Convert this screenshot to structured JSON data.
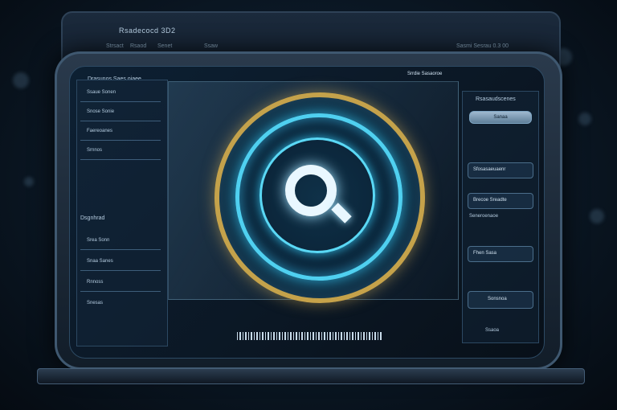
{
  "back_monitor": {
    "title": "Rsadecocd 3D2",
    "menu": [
      "Strsact",
      "Rsaod",
      "Senet",
      "Ssaw"
    ],
    "right_text": "Sasmi Sesrau 0.3  00"
  },
  "screen": {
    "top_left_title": "Drasunos Saes oiaee",
    "top_pill": "Srrdie Sasaoroe",
    "left_panel": {
      "heading": "Dsgnhrad",
      "rows": [
        "Ssaue Sonen",
        "Snose Sonie",
        "Faereoanes",
        "Srnnos",
        "Srea Sonn",
        "Snaa Sanes",
        "Rnnoss",
        "Snesas"
      ]
    },
    "right_panel": {
      "heading": "Rsasaudscenes",
      "button": "Sanaa",
      "items": [
        "Sfosasaeuaenr",
        "Brecoe Sreadte",
        "Seneroenaoe",
        "Fhen Sasa",
        "Sonsnoa",
        "Ssaoa"
      ]
    },
    "barcode_label": "|||| |||| |||||| ||||"
  },
  "colors": {
    "accent_cyan": "#4fd0f0",
    "accent_gold": "#c6a24a"
  },
  "icons": {
    "center_logo": "q-logo-icon"
  }
}
